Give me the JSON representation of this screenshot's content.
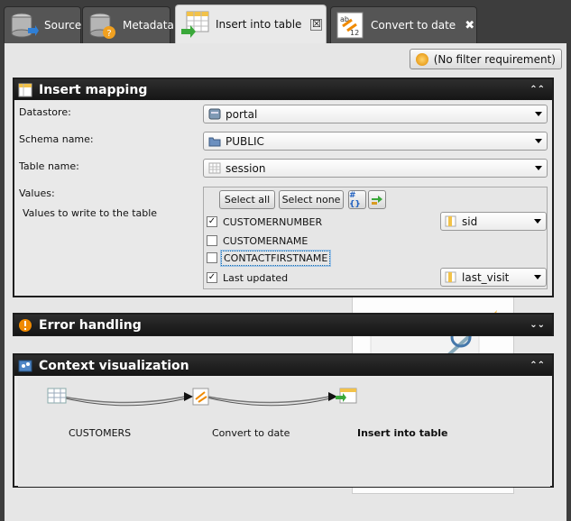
{
  "tabs": [
    {
      "label": "Source",
      "icon": "database-import-icon",
      "active": false
    },
    {
      "label": "Metadata",
      "icon": "database-help-icon",
      "active": false
    },
    {
      "label": "Insert into table",
      "icon": "table-insert-icon",
      "active": true,
      "close": "☒"
    },
    {
      "label": "Convert to date",
      "icon": "convert-date-icon",
      "active": false,
      "close": "✖"
    }
  ],
  "toolbar": {
    "filter_button": "(No filter requirement)"
  },
  "insert_mapping": {
    "title": "Insert mapping",
    "collapse": "⌃",
    "datastore_label": "Datastore:",
    "datastore_value": "portal",
    "schema_label": "Schema name:",
    "schema_value": "PUBLIC",
    "table_label": "Table name:",
    "table_value": "session",
    "values_label": "Values:",
    "values_hint": "Values to write to the table",
    "select_all": "Select all",
    "select_none": "Select none",
    "columns": [
      {
        "name": "CUSTOMERNUMBER",
        "checked": true,
        "mapped_to": "sid"
      },
      {
        "name": "CUSTOMERNAME",
        "checked": false,
        "mapped_to": ""
      },
      {
        "name": "CONTACTFIRSTNAME",
        "checked": false,
        "mapped_to": ""
      },
      {
        "name": "Last updated",
        "checked": true,
        "mapped_to": "last_visit"
      }
    ]
  },
  "error_handling": {
    "title": "Error handling",
    "collapse": "⌄"
  },
  "context": {
    "title": "Context visualization",
    "collapse": "⌃",
    "nodes": [
      "CUSTOMERS",
      "Convert to date",
      "Insert into table"
    ]
  },
  "colors": {
    "accent_orange": "#f08a00",
    "header_dark": "#1e1e1e",
    "panel_bg": "#e6e6e6"
  }
}
